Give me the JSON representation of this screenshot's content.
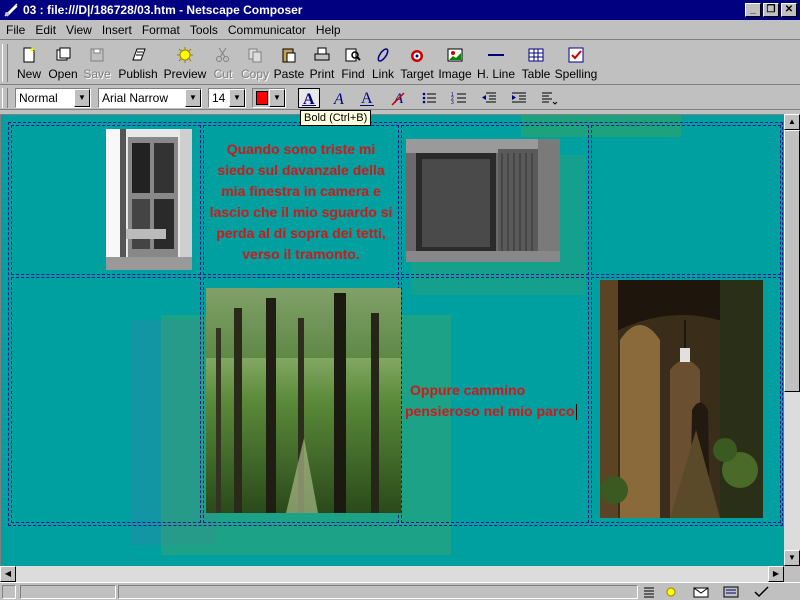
{
  "window": {
    "title": "03 : file:///D|/186728/03.htm - Netscape Composer"
  },
  "menu": [
    {
      "label": "File"
    },
    {
      "label": "Edit"
    },
    {
      "label": "View"
    },
    {
      "label": "Insert"
    },
    {
      "label": "Format"
    },
    {
      "label": "Tools"
    },
    {
      "label": "Communicator"
    },
    {
      "label": "Help"
    }
  ],
  "toolbar": {
    "new": "New",
    "open": "Open",
    "save": "Save",
    "publish": "Publish",
    "preview": "Preview",
    "cut": "Cut",
    "copy": "Copy",
    "paste": "Paste",
    "print": "Print",
    "find": "Find",
    "link": "Link",
    "target": "Target",
    "image": "Image",
    "hline": "H. Line",
    "table": "Table",
    "spelling": "Spelling"
  },
  "format": {
    "paragraph_style": "Normal",
    "font_face": "Arial Narrow",
    "font_size": "14",
    "text_color": "#ff0000",
    "bold_tooltip": "Bold (Ctrl+B)"
  },
  "document": {
    "text1_lines": [
      "Quando sono triste mi",
      "siedo sul davanzale della",
      "mia finestra in camera e",
      "lascio che il mio sguardo si",
      "perda al di sopra dei tetti,",
      "verso il tramonto."
    ],
    "text2_lines": [
      "Oppure cammino",
      "pensieroso nel mio parco"
    ],
    "background_color": "#00a0a0",
    "text_color": "#d01818"
  }
}
